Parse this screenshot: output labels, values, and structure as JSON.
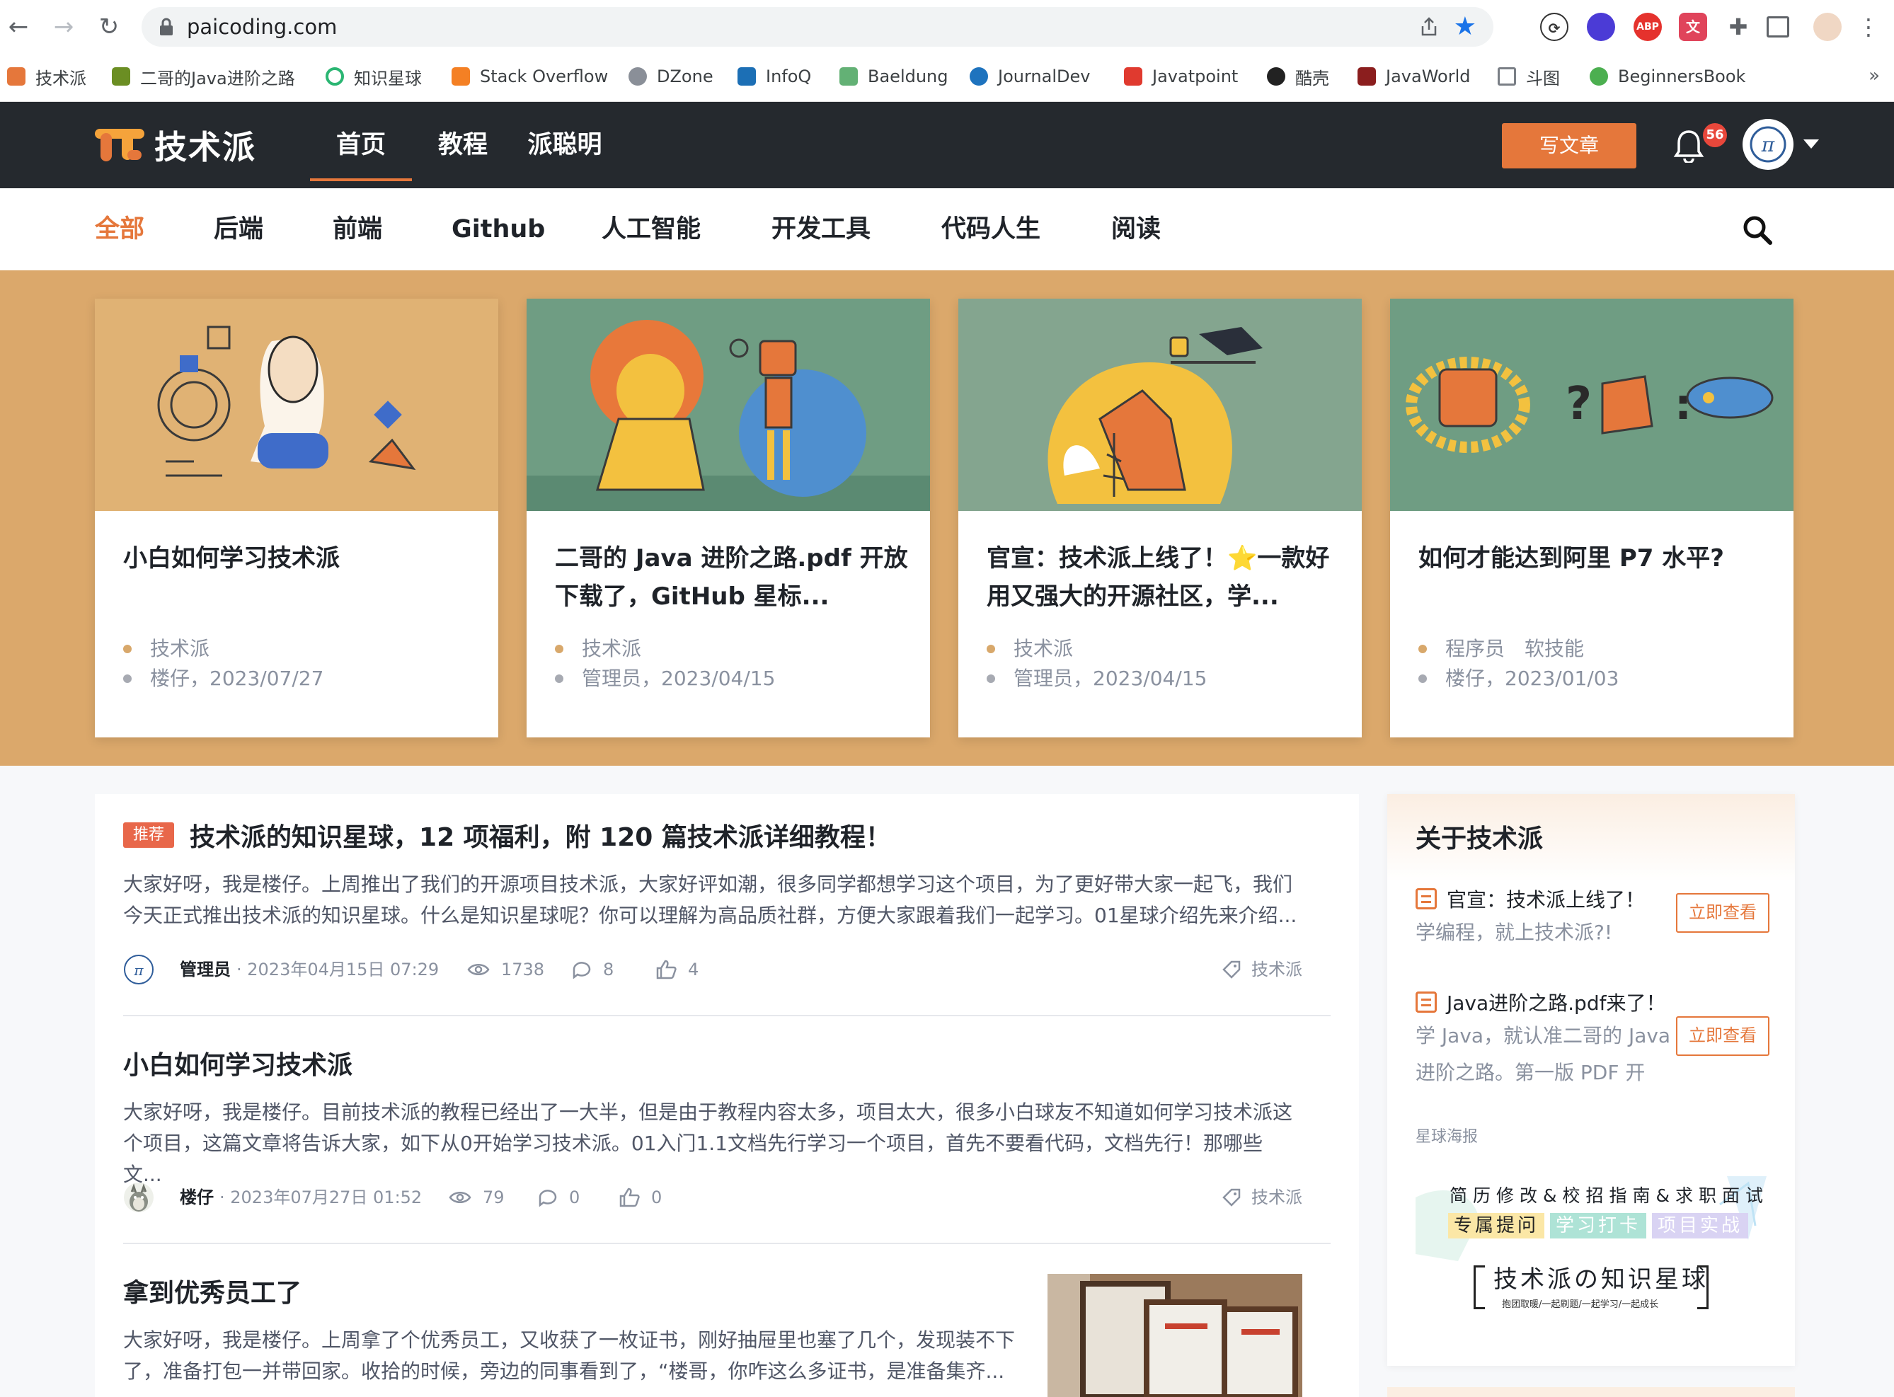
{
  "browser": {
    "url": "paicoding.com",
    "bookmarks": [
      {
        "label": "技术派",
        "color": "#e5773b"
      },
      {
        "label": "二哥的Java进阶之路",
        "color": "#6b8e23"
      },
      {
        "label": "知识星球",
        "color": "#2bb673"
      },
      {
        "label": "Stack Overflow",
        "color": "#f48024"
      },
      {
        "label": "DZone",
        "color": "#8a8f98"
      },
      {
        "label": "InfoQ",
        "color": "#1c6fb5"
      },
      {
        "label": "Baeldung",
        "color": "#63b175"
      },
      {
        "label": "JournalDev",
        "color": "#1e73be"
      },
      {
        "label": "Javatpoint",
        "color": "#e03a2f"
      },
      {
        "label": "酷壳",
        "color": "#222222"
      },
      {
        "label": "JavaWorld",
        "color": "#8b1e1e"
      },
      {
        "label": "斗图",
        "color": "#9aa0a6"
      },
      {
        "label": "BeginnersBook",
        "color": "#4caf50"
      }
    ],
    "more": "»",
    "extensions": {
      "abp": "ABP"
    }
  },
  "header": {
    "logo_text": "技术派",
    "nav": [
      "首页",
      "教程",
      "派聪明"
    ],
    "write_label": "写文章",
    "notification_count": "56",
    "avatar_text": "π"
  },
  "categories": [
    "全部",
    "后端",
    "前端",
    "Github",
    "人工智能",
    "开发工具",
    "代码人生",
    "阅读"
  ],
  "featured": [
    {
      "title": "小白如何学习技术派",
      "tags": [
        "技术派"
      ],
      "meta": "楼仔，2023/07/27"
    },
    {
      "title": "二哥的 Java 进阶之路.pdf 开放下载了，GitHub 星标...",
      "tags": [
        "技术派"
      ],
      "meta": "管理员，2023/04/15"
    },
    {
      "title": "官宣：技术派上线了！⭐一款好用又强大的开源社区，学...",
      "tags": [
        "技术派"
      ],
      "meta": "管理员，2023/04/15"
    },
    {
      "title": "如何才能达到阿里 P7 水平?",
      "tags": [
        "程序员",
        "软技能"
      ],
      "meta": "楼仔，2023/01/03"
    }
  ],
  "articles": [
    {
      "badge": "推荐",
      "title": "技术派的知识星球，12 项福利，附 120 篇技术派详细教程！",
      "summary": "大家好呀，我是楼仔。上周推出了我们的开源项目技术派，大家好评如潮，很多同学都想学习这个项目，为了更好带大家一起飞，我们今天正式推出技术派的知识星球。什么是知识星球呢？你可以理解为高品质社群，方便大家跟着我们一起学习。01星球介绍先来介绍...",
      "author": "管理员",
      "date": "· 2023年04月15日 07:29",
      "views": "1738",
      "comments": "8",
      "likes": "4",
      "tag": "技术派"
    },
    {
      "badge": "",
      "title": "小白如何学习技术派",
      "summary": "大家好呀，我是楼仔。目前技术派的教程已经出了一大半，但是由于教程内容太多，项目太大，很多小白球友不知道如何学习技术派这个项目，这篇文章将告诉大家，如下从0开始学习技术派。01入门1.1文档先行学习一个项目，首先不要看代码，文档先行！那哪些文...",
      "author": "楼仔",
      "date": "· 2023年07月27日 01:52",
      "views": "79",
      "comments": "0",
      "likes": "0",
      "tag": "技术派"
    },
    {
      "badge": "",
      "title": "拿到优秀员工了",
      "summary": "大家好呀，我是楼仔。上周拿了个优秀员工，又收获了一枚证书，刚好抽屉里也塞了几个，发现装不下了，准备打包一并带回家。收拾的时候，旁边的同事看到了，“楼哥，你咋这么多证书，是准备集齐..."
    }
  ],
  "sidebar": {
    "title": "关于技术派",
    "items": [
      {
        "title": "官宣：技术派上线了！",
        "desc": "学编程，就上技术派?!",
        "button": "立即查看"
      },
      {
        "title": "Java进阶之路.pdf来了！",
        "desc": "学 Java，就认准二哥的 Java 进阶之路。第一版 PDF 开放...",
        "button": "立即查看"
      }
    ],
    "poster_label": "星球海报",
    "poster": {
      "line1": "简历修改&校招指南&求职面试",
      "chips": [
        "专属提问",
        "学习打卡",
        "项目实战"
      ],
      "main": "技术派の知识星球",
      "sub": "抱团取暖/一起刷题/一起学习/一起成长"
    }
  }
}
